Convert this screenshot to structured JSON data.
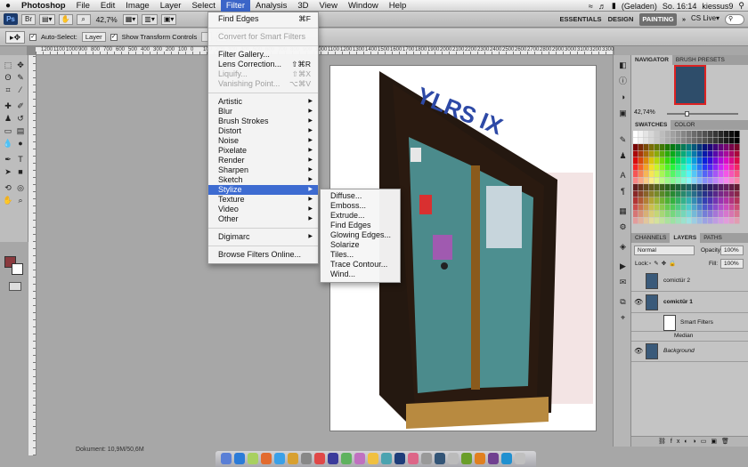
{
  "menubar": {
    "apple": "",
    "items": [
      "Photoshop",
      "File",
      "Edit",
      "Image",
      "Layer",
      "Select",
      "Filter",
      "Analysis",
      "3D",
      "View",
      "Window",
      "Help"
    ],
    "active": "Filter",
    "status": {
      "battery": "(Geladen)",
      "clock": "So. 16:14",
      "user": "kiessus9"
    }
  },
  "appbar": {
    "zoom": "42,7%",
    "workspaces": [
      "ESSENTIALS",
      "DESIGN",
      "PAINTING",
      "»"
    ],
    "cslive": "CS Live▾"
  },
  "options": {
    "auto_select_label": "Auto-Select:",
    "auto_select_value": "Layer",
    "show_transform_label": "Show Transform Controls"
  },
  "ruler_numbers": [
    "1200",
    "1100",
    "1000",
    "900",
    "800",
    "700",
    "600",
    "500",
    "400",
    "300",
    "200",
    "100",
    "0",
    "100",
    "200",
    "300",
    "400",
    "500",
    "600",
    "700",
    "800",
    "900",
    "1000",
    "1100",
    "1200",
    "1300",
    "1400",
    "1500",
    "1600",
    "1700",
    "1800",
    "1900",
    "2000",
    "2100",
    "2200",
    "2300",
    "2400",
    "2500",
    "2600",
    "2700",
    "2800",
    "2900",
    "3000",
    "3100",
    "3200",
    "3300"
  ],
  "status_text": "Dokument: 10,9M/50,6M",
  "filter_menu": {
    "items": [
      {
        "label": "Find Edges",
        "shortcut": "⌘F",
        "disabled": false,
        "sub": false
      },
      {
        "sep": true
      },
      {
        "label": "Convert for Smart Filters",
        "shortcut": "",
        "disabled": true,
        "sub": false
      },
      {
        "sep": true
      },
      {
        "label": "Filter Gallery...",
        "shortcut": "",
        "disabled": false,
        "sub": false
      },
      {
        "label": "Lens Correction...",
        "shortcut": "⇧⌘R",
        "disabled": false,
        "sub": false
      },
      {
        "label": "Liquify...",
        "shortcut": "⇧⌘X",
        "disabled": true,
        "sub": false
      },
      {
        "label": "Vanishing Point...",
        "shortcut": "⌥⌘V",
        "disabled": true,
        "sub": false
      },
      {
        "sep": true
      },
      {
        "label": "Artistic",
        "sub": true
      },
      {
        "label": "Blur",
        "sub": true
      },
      {
        "label": "Brush Strokes",
        "sub": true
      },
      {
        "label": "Distort",
        "sub": true
      },
      {
        "label": "Noise",
        "sub": true
      },
      {
        "label": "Pixelate",
        "sub": true
      },
      {
        "label": "Render",
        "sub": true
      },
      {
        "label": "Sharpen",
        "sub": true
      },
      {
        "label": "Sketch",
        "sub": true
      },
      {
        "label": "Stylize",
        "sub": true,
        "highlight": true
      },
      {
        "label": "Texture",
        "sub": true
      },
      {
        "label": "Video",
        "sub": true
      },
      {
        "label": "Other",
        "sub": true
      },
      {
        "sep": true
      },
      {
        "label": "Digimarc",
        "sub": true
      },
      {
        "sep": true
      },
      {
        "label": "Browse Filters Online...",
        "sub": false
      }
    ]
  },
  "stylize_submenu": [
    "Diffuse...",
    "Emboss...",
    "Extrude...",
    "Find Edges",
    "Glowing Edges...",
    "Solarize",
    "Tiles...",
    "Trace Contour...",
    "Wind..."
  ],
  "panels": {
    "navigator_tabs": [
      "NAVIGATOR",
      "BRUSH PRESETS"
    ],
    "nav_zoom": "42,74%",
    "swatch_tabs": [
      "SWATCHES",
      "COLOR"
    ],
    "layer_tabs": [
      "CHANNELS",
      "LAYERS",
      "PATHS"
    ],
    "blend_mode": "Normal",
    "opacity_label": "Opacity:",
    "opacity_value": "100%",
    "lock_label": "Lock:",
    "fill_label": "Fill:",
    "fill_value": "100%",
    "layers": [
      "comictür 2",
      "comictür 1",
      "Smart Filters",
      "Median",
      "Background"
    ]
  },
  "colors": {
    "foreground": "#8a3a3e",
    "background": "#ffffff",
    "menu_highlight": "#3d6bd1"
  }
}
